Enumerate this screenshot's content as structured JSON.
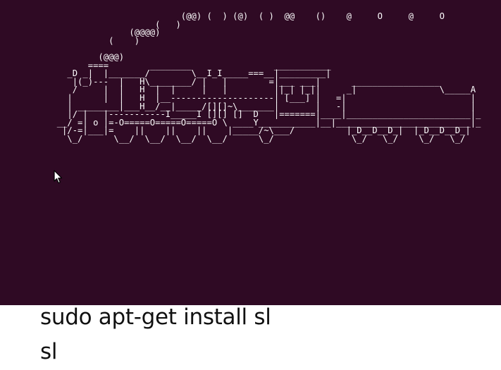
{
  "terminal": {
    "background": "#2f0a24",
    "foreground": "#ffffff",
    "ascii_lines": [
      "                                   (@@) (  ) (@)  ( )  @@    ()    @     O     @     O",
      "                              (   )",
      "                         (@@@@)",
      "                     (    )",
      "",
      "                   (@@@)",
      "                 ====        ________                ___________",
      "             _D _|  |_______/        \\__I_I_____===__|_________|",
      "              |(_)---  |   H\\________/ |   |        =|___ ___|      _________________",
      "              /     |  |   H  |  |     |   |         ||_| |_||     _|                \\_____A",
      "             |      |  |   H  |__--------------------| [___] |   =|                        |",
      "             | ________|___H__/__|_____/[][]~\\_______|       |   -|                        |",
      "             |/ |   |-----------I_____I [][] []  D   |=======|____|________________________|_",
      "           __/ =| o |=-O=====O=====O=====O \\ ____Y___________|__|__________________________|_",
      "            |/-=|___|=    ||    ||    ||    |_____/~\\___/          |_D__D__D_|  |_D__D__D_|",
      "             \\_/      \\__/  \\__/  \\__/  \\__/      \\_/               \\_/   \\_/    \\_/   \\_/"
    ]
  },
  "icons": {
    "cursor": "mouse-pointer-icon"
  },
  "caption": {
    "line1": "sudo apt-get install sl",
    "line2": "sl"
  }
}
